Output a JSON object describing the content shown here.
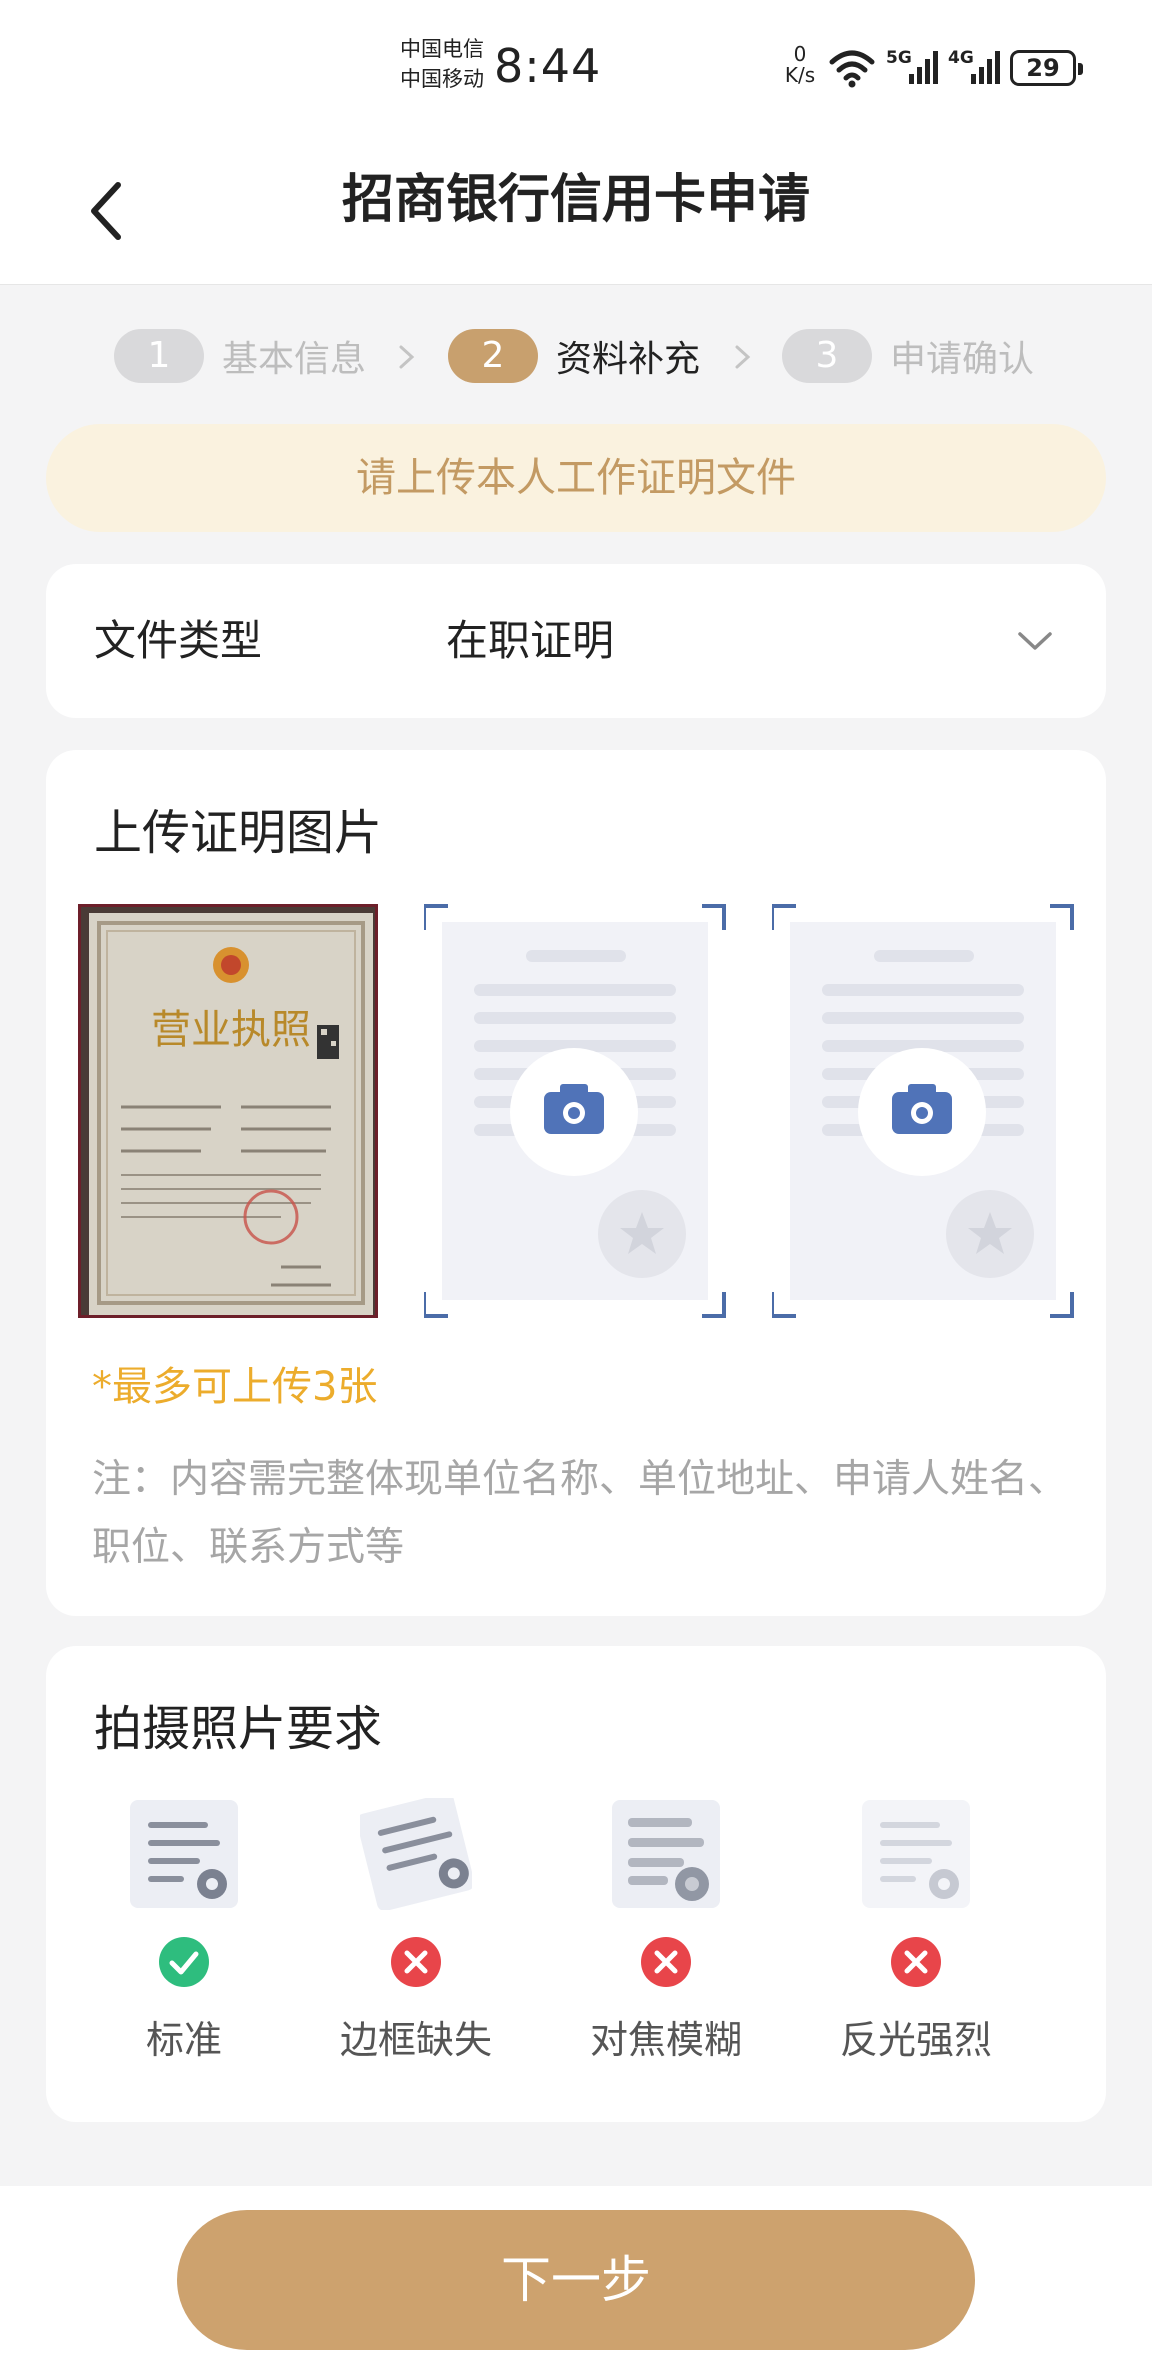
{
  "status_bar": {
    "carrier_1": "中国电信",
    "carrier_2": "中国移动",
    "time": "8:44",
    "net_speed_value": "0",
    "net_speed_unit": "K/s",
    "signal_1_type": "5G",
    "signal_2_type": "4G",
    "battery": "29",
    "icons": [
      "wifi-icon",
      "signal-icon",
      "signal-icon",
      "battery-icon"
    ]
  },
  "header": {
    "title": "招商银行信用卡申请",
    "back_icon": "chevron-left-icon"
  },
  "stepper": {
    "steps": [
      {
        "number": "1",
        "label": "基本信息",
        "active": false
      },
      {
        "number": "2",
        "label": "资料补充",
        "active": true
      },
      {
        "number": "3",
        "label": "申请确认",
        "active": false
      }
    ]
  },
  "notice": {
    "text": "请上传本人工作证明文件"
  },
  "file_type": {
    "label": "文件类型",
    "value": "在职证明",
    "icon": "chevron-down-icon"
  },
  "upload": {
    "title": "上传证明图片",
    "uploaded_photo": "business-license-photo",
    "placeholder_icon": "camera-icon",
    "placeholder_count": 2,
    "max_hint": "*最多可上传3张",
    "note": "注：内容需完整体现单位名称、单位地址、申请人姓名、职位、联系方式等"
  },
  "requirements": {
    "title": "拍摄照片要求",
    "items": [
      {
        "label": "标准",
        "status": "ok"
      },
      {
        "label": "边框缺失",
        "status": "bad"
      },
      {
        "label": "对焦模糊",
        "status": "bad"
      },
      {
        "label": "反光强烈",
        "status": "bad"
      }
    ]
  },
  "next_button": {
    "label": "下一步"
  },
  "colors": {
    "accent": "#cda26e",
    "notice_bg": "#faf2df",
    "notice_text": "#c39a63",
    "hint_orange": "#ecac2c",
    "ok_green": "#2ebd7e",
    "bad_red": "#e8454a",
    "camera_blue": "#5073b8"
  }
}
